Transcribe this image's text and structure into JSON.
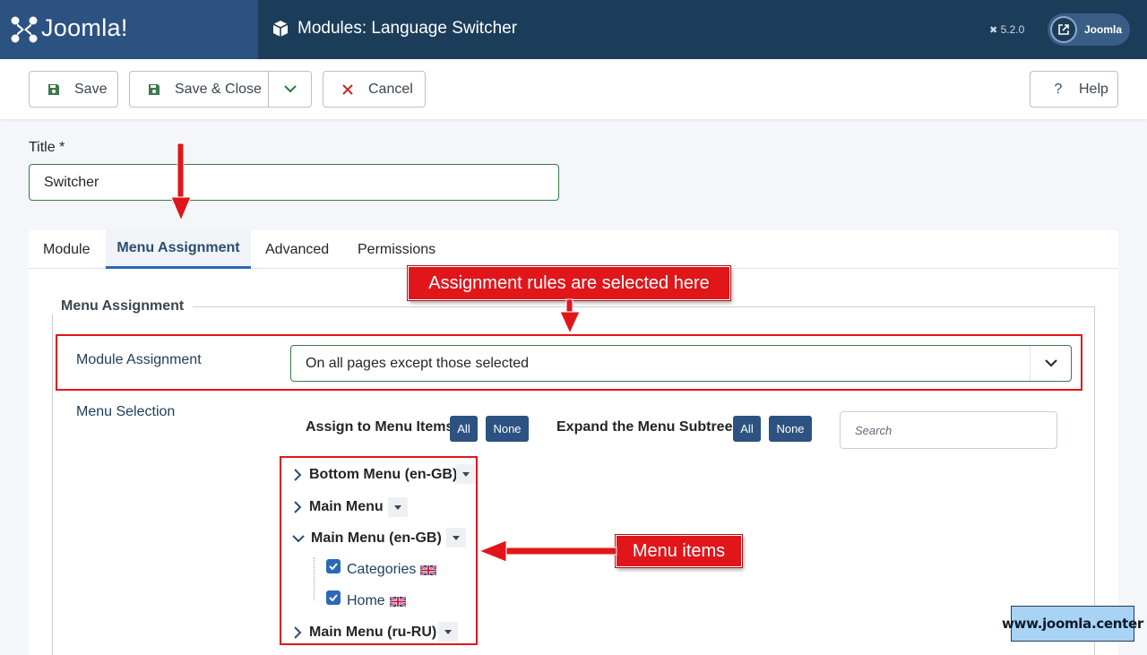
{
  "header": {
    "logo_text": "Joomla!",
    "page_title": "Modules: Language Switcher",
    "version": "5.2.0",
    "user_label": "Joomla"
  },
  "toolbar": {
    "save_label": "Save",
    "save_close_label": "Save & Close",
    "cancel_label": "Cancel",
    "help_label": "Help"
  },
  "title_field": {
    "label": "Title *",
    "value": "Switcher"
  },
  "tabs": [
    {
      "label": "Module",
      "active": false
    },
    {
      "label": "Menu Assignment",
      "active": true
    },
    {
      "label": "Advanced",
      "active": false
    },
    {
      "label": "Permissions",
      "active": false
    }
  ],
  "menu_assignment": {
    "legend": "Menu Assignment",
    "module_assignment_label": "Module Assignment",
    "module_assignment_value": "On all pages except those selected",
    "menu_selection_label": "Menu Selection",
    "assign_label": "Assign to Menu Items",
    "expand_label": "Expand the Menu Subtrees",
    "all_label": "All",
    "none_label": "None",
    "search_placeholder": "Search"
  },
  "tree": {
    "menus": [
      {
        "name": "Bottom Menu (en-GB)",
        "expanded": false
      },
      {
        "name": "Main Menu",
        "expanded": false
      },
      {
        "name": "Main Menu (en-GB)",
        "expanded": true
      },
      {
        "name": "Main Menu (ru-RU)",
        "expanded": false
      }
    ],
    "children": [
      {
        "name": "Categories",
        "checked": true,
        "flag": "uk-flag-icon"
      },
      {
        "name": "Home",
        "checked": true,
        "flag": "uk-flag-icon"
      }
    ]
  },
  "annotations": {
    "rules_callout": "Assignment rules are selected here",
    "items_callout": "Menu items",
    "watermark": "www.joomla.center"
  },
  "colors": {
    "header_bg": "#1c3d5a",
    "logo_bg": "#2c5282",
    "accent": "#2c5282",
    "annotation_red": "#e0161b",
    "save_green": "#3b7a4c",
    "cancel_red": "#c52827"
  }
}
